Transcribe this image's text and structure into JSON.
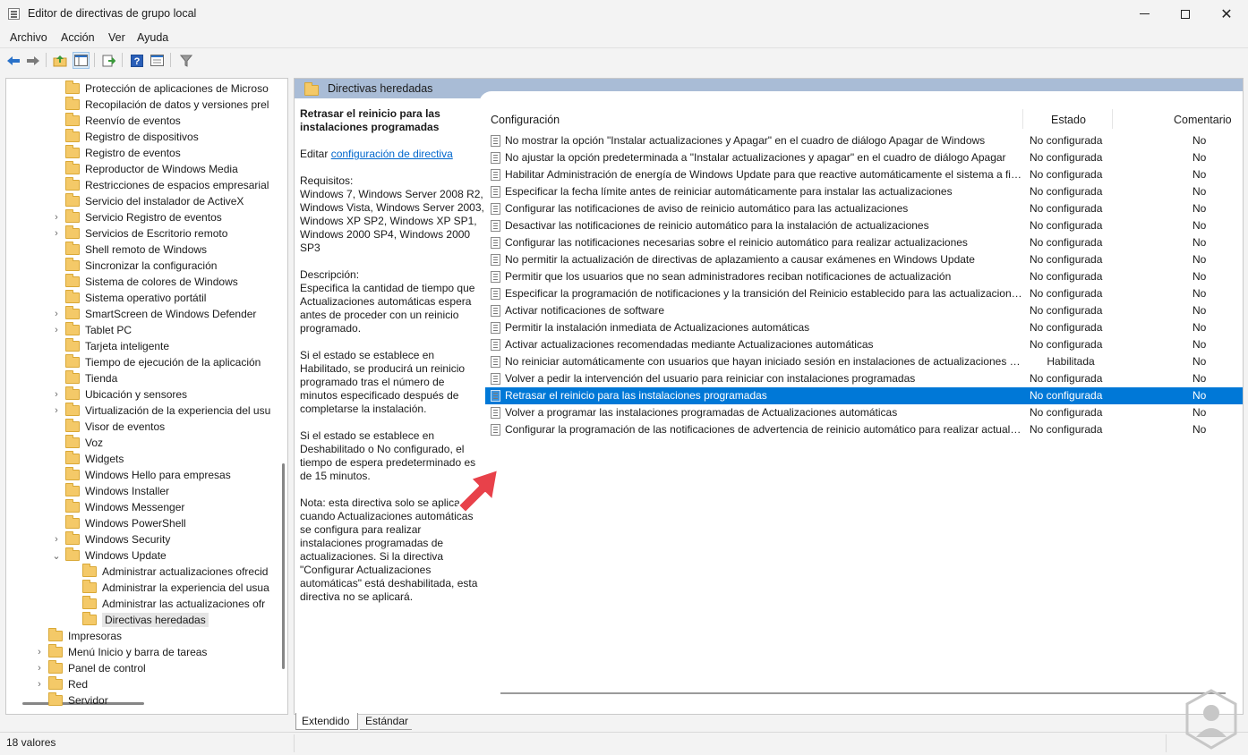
{
  "window": {
    "title": "Editor de directivas de grupo local"
  },
  "menu": [
    "Archivo",
    "Acción",
    "Ver",
    "Ayuda"
  ],
  "toolbar": {
    "icons": [
      "back-arrow-icon",
      "forward-arrow-icon",
      "up-folder-icon",
      "show-hide-tree-icon",
      "export-list-icon",
      "help-icon",
      "properties-icon",
      "filter-icon"
    ]
  },
  "tree": {
    "items": [
      {
        "label": "Protección de aplicaciones de Microso",
        "indent": 2,
        "expander": ""
      },
      {
        "label": "Recopilación de datos y versiones prel",
        "indent": 2,
        "expander": ""
      },
      {
        "label": "Reenvío de eventos",
        "indent": 2,
        "expander": ""
      },
      {
        "label": "Registro de dispositivos",
        "indent": 2,
        "expander": ""
      },
      {
        "label": "Registro de eventos",
        "indent": 2,
        "expander": ""
      },
      {
        "label": "Reproductor de Windows Media",
        "indent": 2,
        "expander": ""
      },
      {
        "label": "Restricciones de espacios empresarial",
        "indent": 2,
        "expander": ""
      },
      {
        "label": "Servicio del instalador de ActiveX",
        "indent": 2,
        "expander": ""
      },
      {
        "label": "Servicio Registro de eventos",
        "indent": 2,
        "expander": "›"
      },
      {
        "label": "Servicios de Escritorio remoto",
        "indent": 2,
        "expander": "›"
      },
      {
        "label": "Shell remoto de Windows",
        "indent": 2,
        "expander": ""
      },
      {
        "label": "Sincronizar la configuración",
        "indent": 2,
        "expander": ""
      },
      {
        "label": "Sistema de colores de Windows",
        "indent": 2,
        "expander": ""
      },
      {
        "label": "Sistema operativo portátil",
        "indent": 2,
        "expander": ""
      },
      {
        "label": "SmartScreen de Windows Defender",
        "indent": 2,
        "expander": "›"
      },
      {
        "label": "Tablet PC",
        "indent": 2,
        "expander": "›"
      },
      {
        "label": "Tarjeta inteligente",
        "indent": 2,
        "expander": ""
      },
      {
        "label": "Tiempo de ejecución de la aplicación",
        "indent": 2,
        "expander": ""
      },
      {
        "label": "Tienda",
        "indent": 2,
        "expander": ""
      },
      {
        "label": "Ubicación y sensores",
        "indent": 2,
        "expander": "›"
      },
      {
        "label": "Virtualización de la experiencia del usu",
        "indent": 2,
        "expander": "›"
      },
      {
        "label": "Visor de eventos",
        "indent": 2,
        "expander": ""
      },
      {
        "label": "Voz",
        "indent": 2,
        "expander": ""
      },
      {
        "label": "Widgets",
        "indent": 2,
        "expander": ""
      },
      {
        "label": "Windows Hello para empresas",
        "indent": 2,
        "expander": ""
      },
      {
        "label": "Windows Installer",
        "indent": 2,
        "expander": ""
      },
      {
        "label": "Windows Messenger",
        "indent": 2,
        "expander": ""
      },
      {
        "label": "Windows PowerShell",
        "indent": 2,
        "expander": ""
      },
      {
        "label": "Windows Security",
        "indent": 2,
        "expander": "›"
      },
      {
        "label": "Windows Update",
        "indent": 2,
        "expander": "⌄"
      },
      {
        "label": "Administrar actualizaciones ofrecid",
        "indent": 3,
        "expander": ""
      },
      {
        "label": "Administrar la experiencia del usua",
        "indent": 3,
        "expander": ""
      },
      {
        "label": "Administrar las actualizaciones ofr",
        "indent": 3,
        "expander": ""
      },
      {
        "label": "Directivas heredadas",
        "indent": 3,
        "expander": "",
        "selected": true
      },
      {
        "label": "Impresoras",
        "indent": 1,
        "expander": ""
      },
      {
        "label": "Menú Inicio y barra de tareas",
        "indent": 1,
        "expander": "›"
      },
      {
        "label": "Panel de control",
        "indent": 1,
        "expander": "›"
      },
      {
        "label": "Red",
        "indent": 1,
        "expander": "›"
      },
      {
        "label": "Servidor",
        "indent": 1,
        "expander": ""
      }
    ]
  },
  "panel": {
    "header": "Directivas heredadas",
    "description": {
      "title": "Retrasar el reinicio para las instalaciones programadas",
      "edit_prefix": "Editar ",
      "edit_link": "configuración de directiva",
      "requirements": "Requisitos:\nWindows 7, Windows Server 2008 R2, Windows Vista, Windows Server 2003, Windows XP SP2, Windows XP SP1, Windows 2000 SP4, Windows 2000 SP3",
      "desc1": "Descripción:\nEspecifica la cantidad de tiempo que Actualizaciones automáticas espera antes de proceder con un reinicio programado.",
      "desc2": "Si el estado se establece en Habilitado, se producirá un reinicio programado tras el número de minutos especificado después de completarse la instalación.",
      "desc3": "Si el estado se establece en Deshabilitado o No configurado, el tiempo de espera predeterminado es de 15 minutos.",
      "desc4": "Nota: esta directiva solo se aplica cuando Actualizaciones automáticas se configura para realizar instalaciones programadas de actualizaciones. Si la directiva \"Configurar Actualizaciones automáticas\" está deshabilitada, esta directiva no se aplicará."
    },
    "columns": {
      "config": "Configuración",
      "estado": "Estado",
      "comentario": "Comentario"
    },
    "rows": [
      {
        "name": "No mostrar la opción \"Instalar actualizaciones y Apagar\" en el cuadro de diálogo Apagar de Windows",
        "estado": "No configurada",
        "comentario": "No"
      },
      {
        "name": "No ajustar la opción predeterminada a \"Instalar actualizaciones y apagar\" en el cuadro de diálogo Apagar",
        "estado": "No configurada",
        "comentario": "No"
      },
      {
        "name": "Habilitar Administración de energía de Windows Update para que reactive automáticamente el sistema a fin de instalar actualizaciones",
        "estado": "No configurada",
        "comentario": "No"
      },
      {
        "name": "Especificar la fecha límite antes de reiniciar automáticamente para instalar las actualizaciones",
        "estado": "No configurada",
        "comentario": "No"
      },
      {
        "name": "Configurar las notificaciones de aviso de reinicio automático para las actualizaciones",
        "estado": "No configurada",
        "comentario": "No"
      },
      {
        "name": "Desactivar las notificaciones de reinicio automático para la instalación de actualizaciones",
        "estado": "No configurada",
        "comentario": "No"
      },
      {
        "name": "Configurar las notificaciones necesarias sobre el reinicio automático para realizar actualizaciones",
        "estado": "No configurada",
        "comentario": "No"
      },
      {
        "name": "No permitir la actualización de directivas de aplazamiento a causar exámenes en Windows Update",
        "estado": "No configurada",
        "comentario": "No"
      },
      {
        "name": "Permitir que los usuarios que no sean administradores reciban notificaciones de actualización",
        "estado": "No configurada",
        "comentario": "No"
      },
      {
        "name": "Especificar la programación de notificaciones y la transición del Reinicio establecido para las actualizaciones",
        "estado": "No configurada",
        "comentario": "No"
      },
      {
        "name": "Activar notificaciones de software",
        "estado": "No configurada",
        "comentario": "No"
      },
      {
        "name": "Permitir la instalación inmediata de Actualizaciones automáticas",
        "estado": "No configurada",
        "comentario": "No"
      },
      {
        "name": "Activar actualizaciones recomendadas mediante Actualizaciones automáticas",
        "estado": "No configurada",
        "comentario": "No"
      },
      {
        "name": "No reiniciar automáticamente con usuarios que hayan iniciado sesión en instalaciones de actualizaciones automáticas programadas",
        "estado": "Habilitada",
        "comentario": "No"
      },
      {
        "name": "Volver a pedir la intervención del usuario para reiniciar con instalaciones programadas",
        "estado": "No configurada",
        "comentario": "No"
      },
      {
        "name": "Retrasar el reinicio para las instalaciones programadas",
        "estado": "No configurada",
        "comentario": "No",
        "selected": true
      },
      {
        "name": "Volver a programar las instalaciones programadas de Actualizaciones automáticas",
        "estado": "No configurada",
        "comentario": "No"
      },
      {
        "name": "Configurar la programación de las notificaciones de advertencia de reinicio automático para realizar actualizaciones",
        "estado": "No configurada",
        "comentario": "No"
      }
    ]
  },
  "tabs": [
    "Extendido",
    "Estándar"
  ],
  "status": {
    "text": "18 valores"
  },
  "colors": {
    "selection": "#0078d7",
    "header": "#a9bcd6",
    "arrow": "#e8414a"
  }
}
